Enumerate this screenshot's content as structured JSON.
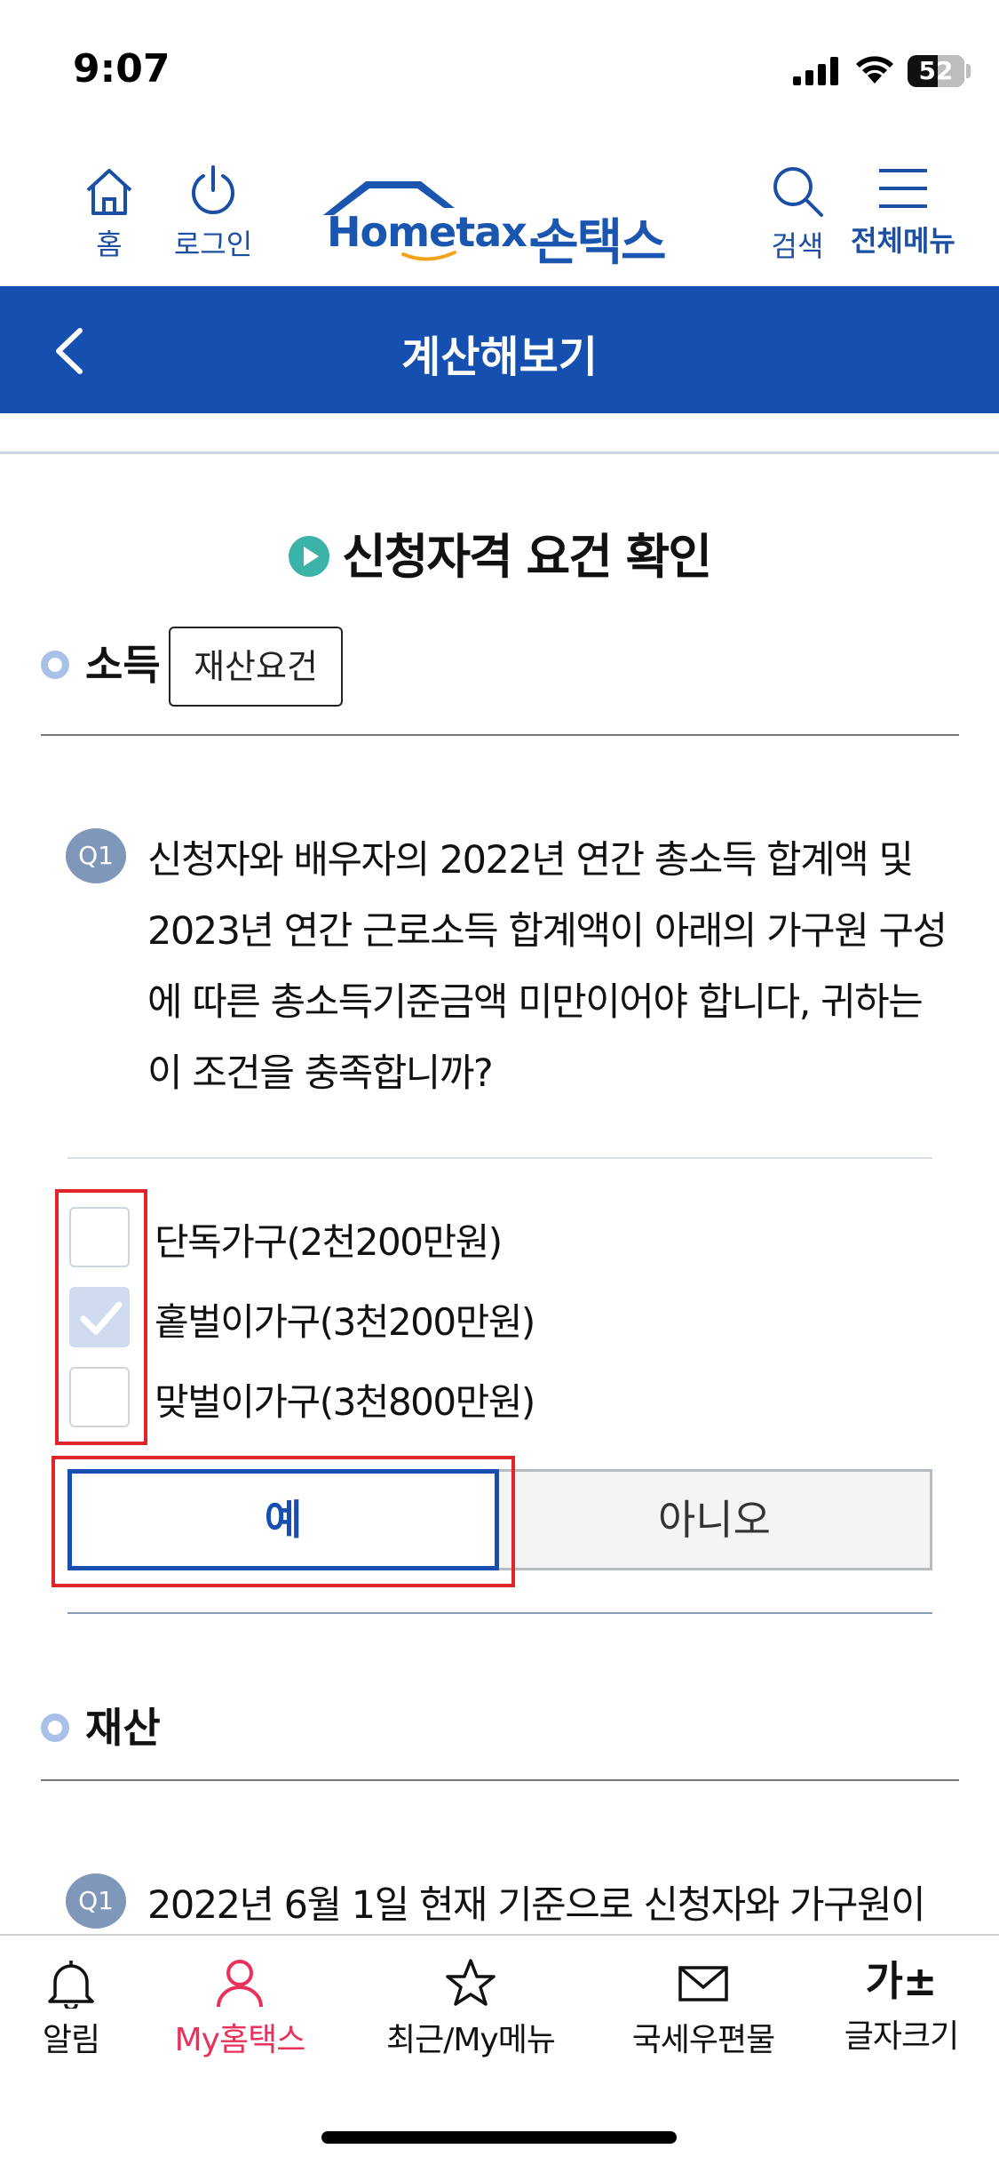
{
  "status_bar": {
    "time": "9:07",
    "battery": "52"
  },
  "header": {
    "home_label": "홈",
    "login_label": "로그인",
    "logo_text": "Hometax.",
    "logo_korean": "손택스",
    "search_label": "검색",
    "menu_label": "전체메뉴"
  },
  "titlebar": {
    "title": "계산해보기"
  },
  "section": {
    "title": "신청자격 요건 확인"
  },
  "income": {
    "heading": "소득",
    "tag_button": "재산요건",
    "question_badge": "Q1",
    "question_text": "신청자와 배우자의 2022년 연간 총소득 합계액 및 2023년 연간 근로소득 합계액이 아래의 가구원 구성에 따른 총소득기준금액 미만이어야 합니다, 귀하는 이 조건을 충족합니까?",
    "options": [
      {
        "label": "단독가구(2천200만원)",
        "checked": false
      },
      {
        "label": "홑벌이가구(3천200만원)",
        "checked": true
      },
      {
        "label": "맞벌이가구(3천800만원)",
        "checked": false
      }
    ],
    "yes_label": "예",
    "no_label": "아니오"
  },
  "property": {
    "heading": "재산",
    "question_badge": "Q1",
    "question_text": "2022년 6월 1일 현재 기준으로 신청자와 가구원이"
  },
  "tabbar": {
    "items": [
      {
        "label": "알림",
        "icon": "bell-icon"
      },
      {
        "label": "My홈택스",
        "icon": "person-icon",
        "active": true
      },
      {
        "label": "최근/My메뉴",
        "icon": "star-icon"
      },
      {
        "label": "국세우편물",
        "icon": "mail-icon"
      },
      {
        "label": "글자크기",
        "icon": "font-size-icon",
        "glyph": "가±"
      }
    ]
  },
  "colors": {
    "primary": "#1550b1",
    "highlight_red": "#e0252d",
    "active_tab": "#e8315b",
    "accent_teal": "#3bb3a8"
  }
}
